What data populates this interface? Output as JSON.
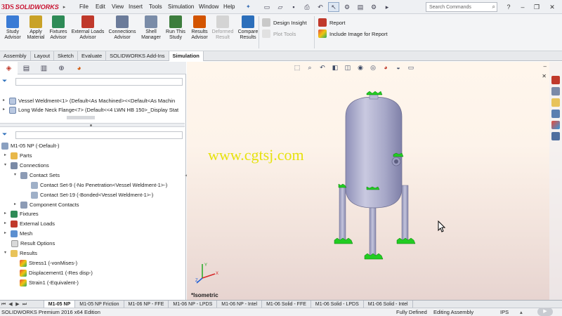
{
  "app": {
    "brand_prefix": "3DS",
    "brand_name": "SOLIDWORKS"
  },
  "menu": [
    "File",
    "Edit",
    "View",
    "Insert",
    "Tools",
    "Simulation",
    "Window",
    "Help"
  ],
  "search": {
    "placeholder": "Search Commands"
  },
  "ribbon": {
    "buttons": [
      {
        "label1": "Study",
        "label2": "Advisor",
        "color": "#3a7bd5"
      },
      {
        "label1": "Apply",
        "label2": "Material",
        "color": "#c9a227"
      },
      {
        "label1": "Fixtures",
        "label2": "Advisor",
        "color": "#2e8b57"
      },
      {
        "label1": "External Loads",
        "label2": "Advisor",
        "color": "#c0392b"
      },
      {
        "label1": "Connections",
        "label2": "Advisor",
        "color": "#6b7b9a"
      },
      {
        "label1": "Shell",
        "label2": "Manager",
        "color": "#7a8ca8"
      },
      {
        "label1": "Run This",
        "label2": "Study",
        "color": "#3d7d3d"
      },
      {
        "label1": "Results",
        "label2": "Advisor",
        "color": "#d35400"
      },
      {
        "label1": "Deformed",
        "label2": "Result",
        "color": "#bbbbbb"
      },
      {
        "label1": "Compare",
        "label2": "Results",
        "color": "#2c6fbb"
      }
    ],
    "design_insight": "Design Insight",
    "plot_tools": "Plot Tools",
    "report": "Report",
    "include_image": "Include Image for Report"
  },
  "cm_tabs": [
    "Assembly",
    "Layout",
    "Sketch",
    "Evaluate",
    "SOLIDWORKS Add-Ins",
    "Simulation"
  ],
  "cm_active": "Simulation",
  "tree_top": [
    "Vessel Weldment<1> (Default<As Machined><<Default<As Machin",
    "Long Wide Neck Flange<7> (Default<<4 LWN HB 150>_Display Stat"
  ],
  "study_tree": {
    "root": "M1-05 NP (-Default-)",
    "parts": "Parts",
    "connections": "Connections",
    "contact_sets": "Contact Sets",
    "contact_set_9": "Contact Set-9 (-No Penetration<Vessel Weldment-1>-)",
    "contact_set_19": "Contact Set-19 (-Bonded<Vessel Weldment-1>-)",
    "component_contacts": "Component Contacts",
    "fixtures": "Fixtures",
    "external_loads": "External Loads",
    "mesh": "Mesh",
    "result_options": "Result Options",
    "results": "Results",
    "stress": "Stress1 (-vonMises-)",
    "displacement": "Displacement1 (-Res disp-)",
    "strain": "Strain1 (-Equivalent-)"
  },
  "viewport": {
    "watermark": "www.cgtsj.com",
    "view_label": "*Isometric",
    "triad_x": "X",
    "triad_y": "Y",
    "triad_z": "Z"
  },
  "study_tabs": [
    "M1-05 NP",
    "M1-05 NP Friction",
    "M1-06 NP - FFE",
    "M1-06 NP - LPDS",
    "M1-06 NP - Intel",
    "M1-06 Solid - FFE",
    "M1-06 Solid - LPDS",
    "M1-06 Solid - Intel"
  ],
  "study_active": "M1-05 NP",
  "status": {
    "edition": "SOLIDWORKS Premium 2016 x64 Edition",
    "defined": "Fully Defined",
    "mode": "Editing Assembly",
    "units": "IPS"
  },
  "colors": {
    "vessel": "#a8a8c6",
    "fixture_green": "#22cc22",
    "watermark": "#e6e20f"
  }
}
